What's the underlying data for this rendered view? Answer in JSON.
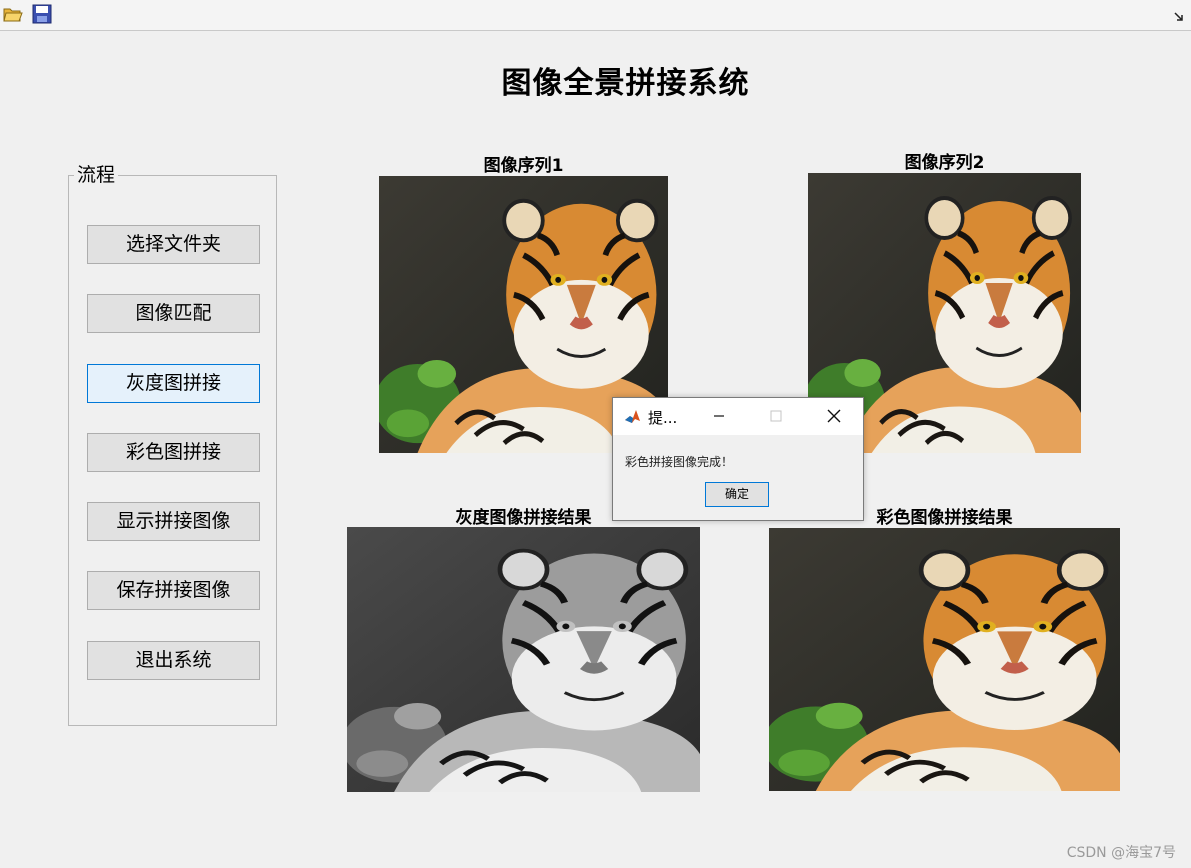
{
  "window": {
    "title": "图像全景拼接系统",
    "toolbar": {
      "icons": [
        "open-folder-icon",
        "save-icon",
        "undock-icon"
      ]
    }
  },
  "panel": {
    "title": "流程",
    "buttons": [
      "选择文件夹",
      "图像匹配",
      "灰度图拼接",
      "彩色图拼接",
      "显示拼接图像",
      "保存拼接图像",
      "退出系统"
    ],
    "focused_index": 2
  },
  "images": {
    "seq1_title": "图像序列1",
    "seq2_title": "图像序列2",
    "gray_title": "灰度图像拼接结果",
    "color_title": "彩色图像拼接结果"
  },
  "dialog": {
    "title": "提...",
    "message": "彩色拼接图像完成！",
    "ok_label": "确定"
  },
  "watermark": "CSDN @海宝7号",
  "colors": {
    "background": "#f0f0f0",
    "button": "#e1e1e1",
    "focus_border": "#0078d7",
    "tiger_orange": "#d88a33"
  }
}
